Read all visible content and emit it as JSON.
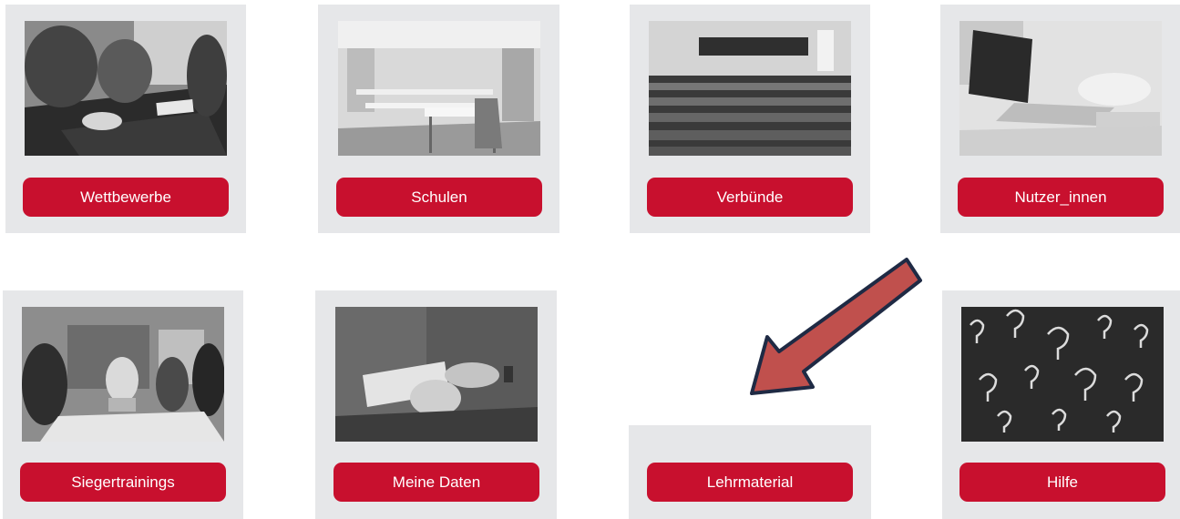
{
  "tiles": [
    {
      "id": "wettbewerbe",
      "label": "Wettbewerbe",
      "image": "meeting-table-photo"
    },
    {
      "id": "schulen",
      "label": "Schulen",
      "image": "classroom-photo"
    },
    {
      "id": "verbuende",
      "label": "Verbünde",
      "image": "lecture-hall-photo"
    },
    {
      "id": "nutzer_innen",
      "label": "Nutzer_innen",
      "image": "laptop-work-photo"
    },
    {
      "id": "siegertrainings",
      "label": "Siegertrainings",
      "image": "team-meeting-photo"
    },
    {
      "id": "meine_daten",
      "label": "Meine Daten",
      "image": "hands-document-photo"
    },
    {
      "id": "lehrmaterial",
      "label": "Lehrmaterial",
      "image": ""
    },
    {
      "id": "hilfe",
      "label": "Hilfe",
      "image": "question-marks-chalkboard-photo"
    }
  ],
  "annotation": {
    "icon": "pointer-arrow-icon",
    "fill": "#c0504d",
    "stroke": "#1f2a44"
  }
}
